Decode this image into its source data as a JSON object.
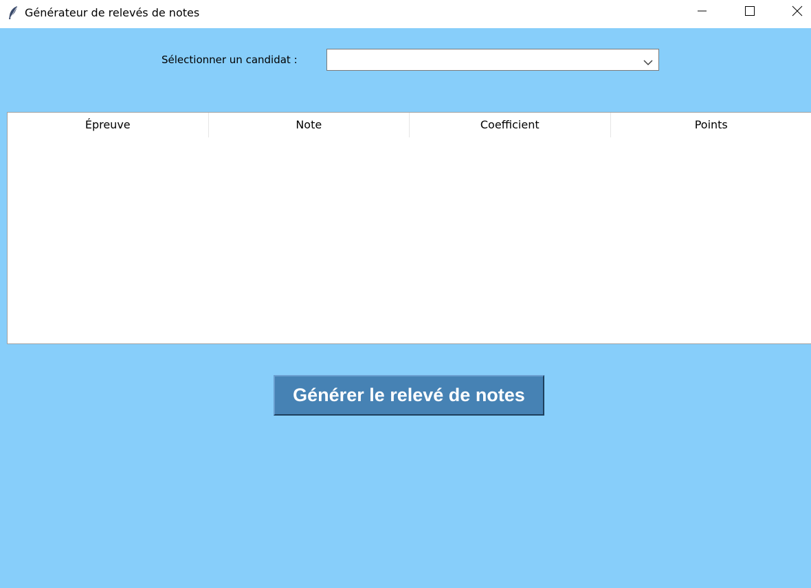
{
  "window": {
    "title": "Générateur de relevés de notes",
    "icon": "feather-icon",
    "controls": [
      "minimize-icon",
      "maximize-icon",
      "close-icon"
    ]
  },
  "colors": {
    "background": "#87cefa",
    "button": "#4682b4",
    "button_text": "#ffffff"
  },
  "candidate": {
    "label": "Sélectionner un candidat :",
    "value": ""
  },
  "table": {
    "columns": [
      "Épreuve",
      "Note",
      "Coefficient",
      "Points"
    ],
    "rows": []
  },
  "actions": {
    "generate_label": "Générer le relevé de notes"
  }
}
